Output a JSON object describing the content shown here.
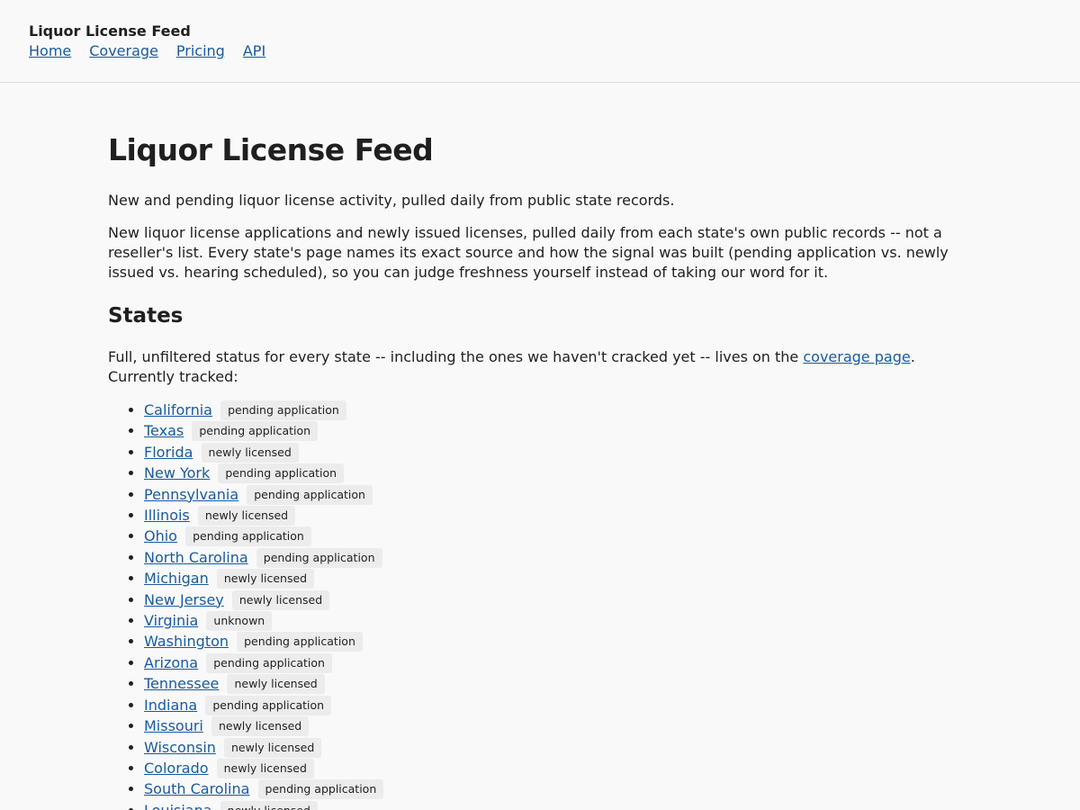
{
  "header": {
    "brand": "Liquor License Feed",
    "nav": [
      "Home",
      "Coverage",
      "Pricing",
      "API"
    ]
  },
  "main": {
    "title": "Liquor License Feed",
    "lead": "New and pending liquor license activity, pulled daily from public state records.",
    "description": "New liquor license applications and newly issued licenses, pulled daily from each state's own public records -- not a reseller's list. Every state's page names its exact source and how the signal was built (pending application vs. newly issued vs. hearing scheduled), so you can judge freshness yourself instead of taking our word for it.",
    "states_heading": "States",
    "states_intro_before": "Full, unfiltered status for every state -- including the ones we haven't cracked yet -- lives on the ",
    "states_intro_link": "coverage page",
    "states_intro_after": ". Currently tracked:",
    "states": [
      {
        "name": "California",
        "status": "pending application"
      },
      {
        "name": "Texas",
        "status": "pending application"
      },
      {
        "name": "Florida",
        "status": "newly licensed"
      },
      {
        "name": "New York",
        "status": "pending application"
      },
      {
        "name": "Pennsylvania",
        "status": "pending application"
      },
      {
        "name": "Illinois",
        "status": "newly licensed"
      },
      {
        "name": "Ohio",
        "status": "pending application"
      },
      {
        "name": "North Carolina",
        "status": "pending application"
      },
      {
        "name": "Michigan",
        "status": "newly licensed"
      },
      {
        "name": "New Jersey",
        "status": "newly licensed"
      },
      {
        "name": "Virginia",
        "status": "unknown"
      },
      {
        "name": "Washington",
        "status": "pending application"
      },
      {
        "name": "Arizona",
        "status": "pending application"
      },
      {
        "name": "Tennessee",
        "status": "newly licensed"
      },
      {
        "name": "Indiana",
        "status": "pending application"
      },
      {
        "name": "Missouri",
        "status": "newly licensed"
      },
      {
        "name": "Wisconsin",
        "status": "newly licensed"
      },
      {
        "name": "Colorado",
        "status": "newly licensed"
      },
      {
        "name": "South Carolina",
        "status": "pending application"
      },
      {
        "name": "Louisiana",
        "status": "newly licensed"
      }
    ]
  },
  "colors": {
    "link": "#1a5a9e",
    "tag_bg": "#ececec",
    "page_bg": "#f9f9f9"
  }
}
